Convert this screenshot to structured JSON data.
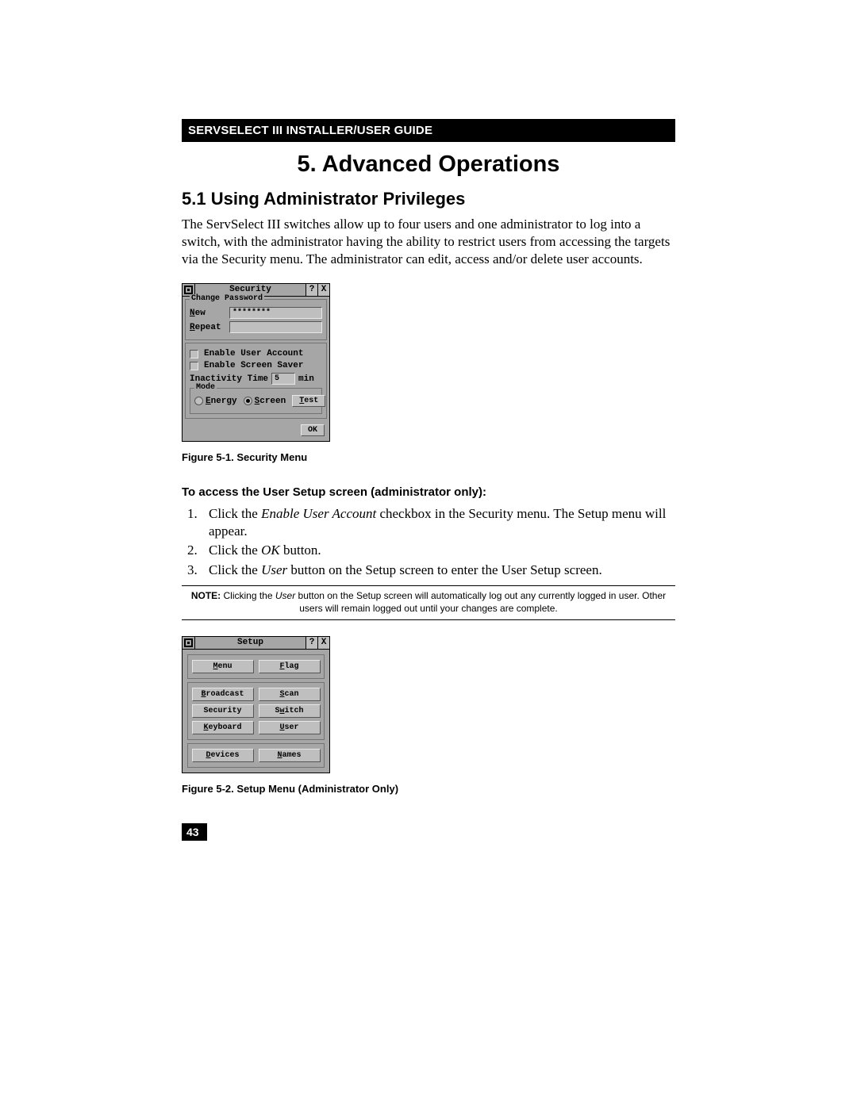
{
  "header": "SERVSELECT III INSTALLER/USER GUIDE",
  "chapter_title": "5.  Advanced Operations",
  "section_title": "5.1  Using Administrator Privileges",
  "intro_paragraph": "The ServSelect III switches allow up to four users and one administrator to log into a switch, with the administrator having the ability to restrict users from accessing the targets via the Security menu. The administrator can edit, access and/or delete user accounts.",
  "fig1": {
    "title": "Security",
    "help_btn": "?",
    "close_btn": "X",
    "grp_pw": "Change Password",
    "new_label_u": "N",
    "new_label_rest": "ew",
    "new_value": "********",
    "repeat_label_u": "R",
    "repeat_label_rest": "epeat",
    "repeat_value": "",
    "enable_user": "Enable User Account",
    "enable_saver": "Enable Screen Saver",
    "inactivity_label": "Inactivity Time",
    "inactivity_value": "5",
    "inactivity_unit": "min",
    "mode_label": "Mode",
    "radio_energy_u": "E",
    "radio_energy_rest": "nergy",
    "radio_screen_u": "S",
    "radio_screen_rest": "creen",
    "test_u": "T",
    "test_rest": "est",
    "ok": "OK"
  },
  "caption1": "Figure 5-1.  Security Menu",
  "subhead1": "To access the User Setup screen (administrator only):",
  "steps": {
    "s1a": "Click the ",
    "s1b": "Enable User Account",
    "s1c": " checkbox in the Security menu. The Setup menu will appear.",
    "s2a": "Click the ",
    "s2b": "OK",
    "s2c": " button.",
    "s3a": "Click the ",
    "s3b": "User",
    "s3c": " button on the Setup screen to enter the User Setup screen."
  },
  "note": {
    "label": "NOTE:",
    "t1": " Clicking the ",
    "em": "User",
    "t2": " button on the Setup screen will automatically log out any currently logged in user. Other users will remain logged out until your changes are complete."
  },
  "fig2": {
    "title": "Setup",
    "help_btn": "?",
    "close_btn": "X",
    "menu_u": "M",
    "menu_rest": "enu",
    "flag_u": "F",
    "flag_rest": "lag",
    "broadcast_u": "B",
    "broadcast_rest": "roadcast",
    "scan_u": "S",
    "scan_rest": "can",
    "security": "Security",
    "switch_u": "S",
    "switch_rest": "witch",
    "keyboard_u": "K",
    "keyboard_rest": "eyboard",
    "user_u": "U",
    "user_rest": "ser",
    "devices_u": "D",
    "devices_rest": "evices",
    "names_u": "N",
    "names_rest": "ames"
  },
  "caption2": "Figure 5-2.  Setup Menu (Administrator Only)",
  "page_number": "43"
}
